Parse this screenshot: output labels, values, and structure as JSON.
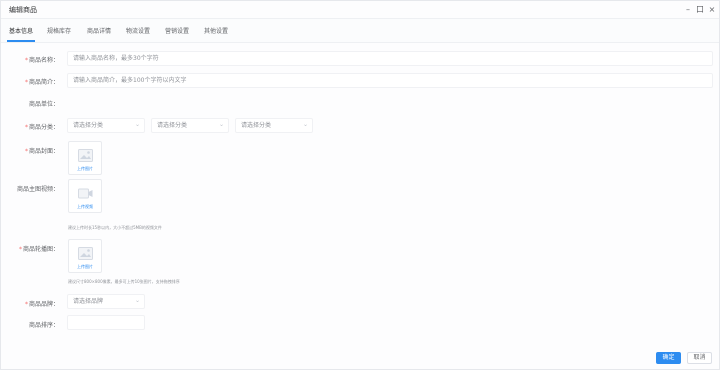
{
  "window": {
    "title": "编辑商品"
  },
  "window_controls": {
    "minimize": "–",
    "restore": "口",
    "close": "×"
  },
  "tabs": [
    {
      "label": "基本信息"
    },
    {
      "label": "规格库存"
    },
    {
      "label": "商品详情"
    },
    {
      "label": "物流设置"
    },
    {
      "label": "营销设置"
    },
    {
      "label": "其他设置"
    }
  ],
  "form": {
    "name": {
      "label": "商品名称：",
      "placeholder": "请输入商品名称，最多30个字符"
    },
    "subtitle": {
      "label": "商品简介：",
      "placeholder": "请输入商品简介，最多100个字符以内文字"
    },
    "unit": {
      "label": "商品单位："
    },
    "category": {
      "label": "商品分类：",
      "selects": [
        "请选择分类",
        "请选择分类",
        "请选择分类"
      ]
    },
    "cover": {
      "label": "商品封面：",
      "upload_text": "上传图片"
    },
    "video": {
      "label": "商品主图视频：",
      "upload_text": "上传视频",
      "hint": "建议上传时长15秒以内，大小不超过5MB的视频文件"
    },
    "gallery": {
      "label": "商品轮播图：",
      "upload_text": "上传图片",
      "hint": "建议尺寸800×800像素，最多可上传10张图片，支持拖拽排序"
    },
    "brand": {
      "label": "商品品牌：",
      "select": "请选择品牌"
    },
    "sort": {
      "label": "商品排序："
    }
  },
  "footer": {
    "confirm": "确定",
    "cancel": "取消"
  },
  "colors": {
    "primary": "#2d8cf0",
    "required": "#f56c6c"
  }
}
